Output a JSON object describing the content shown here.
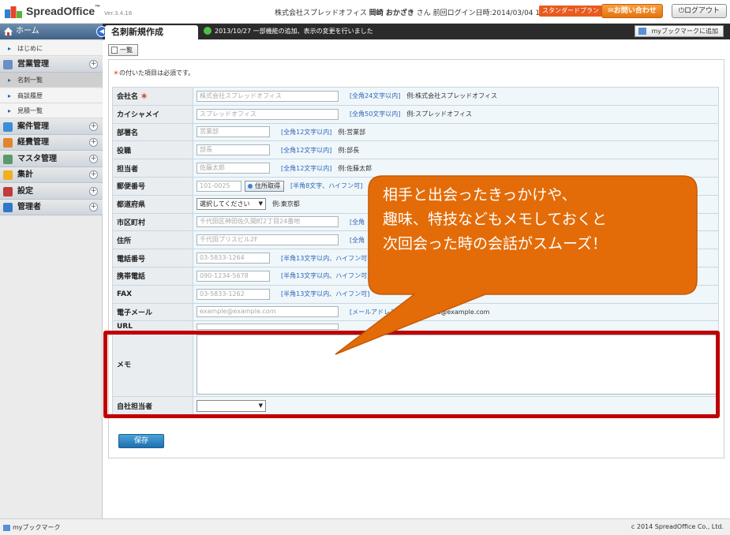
{
  "header": {
    "logo_text": "SpreadOffice",
    "logo_tm": "™",
    "version": "Ver.3.4.16",
    "company": "株式会社スプレッドオフィス",
    "user_name": "岡崎 おかざき",
    "user_suffix": "さん",
    "last_login": "前回ログイン日時:2014/03/04 10:55:26",
    "plan": "スタンダードプラン",
    "contact_label": "お問い合わせ",
    "logout_label": "ログアウト"
  },
  "titlebar": {
    "home_label": "ホーム",
    "page_title": "名刺新規作成",
    "notice": "2013/10/27 一部機能の追加、表示の変更を行いました",
    "mybookmark_add": "myブックマークに追加"
  },
  "sidebar": {
    "items": [
      {
        "type": "sub",
        "label": "はじめに"
      },
      {
        "type": "cat",
        "label": "営業管理",
        "icon_color": "#6b8fc4"
      },
      {
        "type": "sub",
        "label": "名刺一覧",
        "active": true
      },
      {
        "type": "sub",
        "label": "商談履歴"
      },
      {
        "type": "sub",
        "label": "見積一覧"
      },
      {
        "type": "cat",
        "label": "案件管理",
        "icon_color": "#3c8ed6"
      },
      {
        "type": "cat",
        "label": "経費管理",
        "icon_color": "#e0862c"
      },
      {
        "type": "cat",
        "label": "マスタ管理",
        "icon_color": "#5a9a6a"
      },
      {
        "type": "cat",
        "label": "集計",
        "icon_color": "#f0b020"
      },
      {
        "type": "cat",
        "label": "設定",
        "icon_color": "#c23b3b"
      },
      {
        "type": "cat",
        "label": "管理者",
        "icon_color": "#2e77c9"
      }
    ]
  },
  "main": {
    "list_button": "一覧",
    "required_star": "＊",
    "required_note": "の付いた項目は必須です。",
    "save_label": "保存",
    "fields": {
      "company": {
        "label": "会社名",
        "required": "＊",
        "placeholder": "株式会社スプレッドオフィス",
        "hint": "[全角24文字以内]",
        "example": "例:株式会社スプレッドオフィス"
      },
      "kana": {
        "label": "カイシャメイ",
        "placeholder": "スプレッドオフィス",
        "hint": "[全角50文字以内]",
        "example": "例:スプレッドオフィス"
      },
      "dept": {
        "label": "部署名",
        "placeholder": "営業部",
        "hint": "[全角12文字以内]",
        "example": "例:営業部"
      },
      "title": {
        "label": "役職",
        "placeholder": "部長",
        "hint": "[全角12文字以内]",
        "example": "例:部長"
      },
      "person": {
        "label": "担当者",
        "placeholder": "佐藤太郎",
        "hint": "[全角12文字以内]",
        "example": "例:佐藤太郎"
      },
      "zip": {
        "label": "郵便番号",
        "placeholder": "101-0025",
        "button": "住所取得",
        "hint": "[半角8文字、ハイフン可]"
      },
      "pref": {
        "label": "都道府県",
        "selected": "選択してください",
        "example": "例:東京都"
      },
      "city": {
        "label": "市区町村",
        "placeholder": "千代田区神田佐久間町2丁目24番地",
        "hint": "[全角"
      },
      "address": {
        "label": "住所",
        "placeholder": "千代田プリスビル2F",
        "hint": "[全角"
      },
      "phone": {
        "label": "電話番号",
        "placeholder": "03-5833-1264",
        "hint": "[半角13文字以内、ハイフン可]"
      },
      "mobile": {
        "label": "携帯電話",
        "placeholder": "090-1234-5678",
        "hint": "[半角13文字以内、ハイフン可]"
      },
      "fax": {
        "label": "FAX",
        "placeholder": "03-5833-1262",
        "hint": "[半角13文字以内、ハイフン可]"
      },
      "email": {
        "label": "電子メール",
        "placeholder": "example@example.com",
        "hint": "[メールアドレス]",
        "example": "例:example@example.com"
      },
      "url": {
        "label": "URL"
      },
      "memo": {
        "label": "メモ"
      },
      "owner": {
        "label": "自社担当者"
      }
    }
  },
  "callout": {
    "lines": [
      "相手と出会ったきっかけや、",
      "趣味、特技などもメモしておくと",
      "次回会った時の会話がスムーズ！"
    ],
    "fill": "#e36c09",
    "highlight": "#c00000"
  },
  "footer": {
    "bookmark_label": "myブックマーク",
    "copyright": "c 2014 SpreadOffice Co., Ltd."
  }
}
